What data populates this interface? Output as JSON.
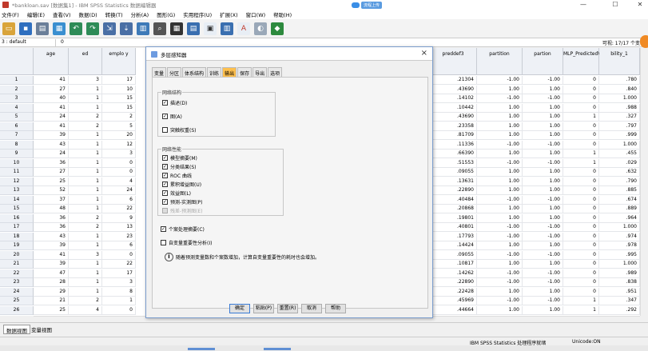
{
  "window": {
    "title": "*bankloan.sav [数据集1] - IBM SPSS Statistics 数据编辑器",
    "cloud_label": "流程上传",
    "controls": [
      "—",
      "☐",
      "✕"
    ]
  },
  "menu": [
    "文件(F)",
    "编辑(E)",
    "查看(V)",
    "数据(D)",
    "转换(T)",
    "分析(A)",
    "图形(G)",
    "实用程序(U)",
    "扩展(X)",
    "窗口(W)",
    "帮助(H)"
  ],
  "refbar": {
    "cell_ref": "3 : default",
    "cell_value": "0",
    "visible": "可视: 17/17 个变"
  },
  "columns": [
    {
      "label": "age",
      "icon": "scale-icon"
    },
    {
      "label": "ed",
      "icon": "ordinal-icon"
    },
    {
      "label": "emplo y",
      "icon": "scale-icon"
    },
    {
      "label": "preddef3",
      "icon": "scale-icon"
    },
    {
      "label": "partition",
      "icon": "nominal-icon"
    },
    {
      "label": "partion",
      "icon": "scale-icon"
    },
    {
      "label": "MLP_PredictedValue",
      "icon": "nominal-icon"
    },
    {
      "label": "bility_1",
      "icon": "scale-icon"
    }
  ],
  "rows": [
    {
      "n": "1",
      "age": "41",
      "ed": "3",
      "emp": "17",
      "pred": ".21304",
      "part": "-1.00",
      "parn": "-1.00",
      "mlp": "0",
      "prob": ".780"
    },
    {
      "n": "2",
      "age": "27",
      "ed": "1",
      "emp": "10",
      "pred": ".43690",
      "part": "1.00",
      "parn": "1.00",
      "mlp": "0",
      "prob": ".840"
    },
    {
      "n": "3",
      "age": "40",
      "ed": "1",
      "emp": "15",
      "pred": ".14102",
      "part": "-1.00",
      "parn": "-1.00",
      "mlp": "0",
      "prob": "1.000"
    },
    {
      "n": "4",
      "age": "41",
      "ed": "1",
      "emp": "15",
      "pred": ".10442",
      "part": "1.00",
      "parn": "1.00",
      "mlp": "0",
      "prob": ".988"
    },
    {
      "n": "5",
      "age": "24",
      "ed": "2",
      "emp": "2",
      "pred": ".43690",
      "part": "1.00",
      "parn": "1.00",
      "mlp": "1",
      "prob": ".327"
    },
    {
      "n": "6",
      "age": "41",
      "ed": "2",
      "emp": "5",
      "pred": ".23358",
      "part": "1.00",
      "parn": "1.00",
      "mlp": "0",
      "prob": ".797"
    },
    {
      "n": "7",
      "age": "39",
      "ed": "1",
      "emp": "20",
      "pred": ".81709",
      "part": "1.00",
      "parn": "1.00",
      "mlp": "0",
      "prob": ".999"
    },
    {
      "n": "8",
      "age": "43",
      "ed": "1",
      "emp": "12",
      "pred": ".11336",
      "part": "-1.00",
      "parn": "-1.00",
      "mlp": "0",
      "prob": "1.000"
    },
    {
      "n": "9",
      "age": "24",
      "ed": "1",
      "emp": "3",
      "pred": ".66390",
      "part": "1.00",
      "parn": "1.00",
      "mlp": "1",
      "prob": ".455"
    },
    {
      "n": "10",
      "age": "36",
      "ed": "1",
      "emp": "0",
      "pred": ".51553",
      "part": "-1.00",
      "parn": "-1.00",
      "mlp": "1",
      "prob": ".029"
    },
    {
      "n": "11",
      "age": "27",
      "ed": "1",
      "emp": "0",
      "pred": ".09055",
      "part": "1.00",
      "parn": "1.00",
      "mlp": "0",
      "prob": ".632"
    },
    {
      "n": "12",
      "age": "25",
      "ed": "1",
      "emp": "4",
      "pred": ".13631",
      "part": "1.00",
      "parn": "1.00",
      "mlp": "0",
      "prob": ".790"
    },
    {
      "n": "13",
      "age": "52",
      "ed": "1",
      "emp": "24",
      "pred": ".22890",
      "part": "1.00",
      "parn": "1.00",
      "mlp": "0",
      "prob": ".885"
    },
    {
      "n": "14",
      "age": "37",
      "ed": "1",
      "emp": "6",
      "pred": ".40484",
      "part": "-1.00",
      "parn": "-1.00",
      "mlp": "0",
      "prob": ".674"
    },
    {
      "n": "15",
      "age": "48",
      "ed": "1",
      "emp": "22",
      "pred": ".20868",
      "part": "1.00",
      "parn": "1.00",
      "mlp": "0",
      "prob": ".889"
    },
    {
      "n": "16",
      "age": "36",
      "ed": "2",
      "emp": "9",
      "pred": ".19801",
      "part": "1.00",
      "parn": "1.00",
      "mlp": "0",
      "prob": ".964"
    },
    {
      "n": "17",
      "age": "36",
      "ed": "2",
      "emp": "13",
      "pred": ".40801",
      "part": "-1.00",
      "parn": "-1.00",
      "mlp": "0",
      "prob": "1.000"
    },
    {
      "n": "18",
      "age": "43",
      "ed": "1",
      "emp": "23",
      "pred": ".17793",
      "part": "-1.00",
      "parn": "-1.00",
      "mlp": "0",
      "prob": ".974"
    },
    {
      "n": "19",
      "age": "39",
      "ed": "1",
      "emp": "6",
      "pred": ".14424",
      "part": "1.00",
      "parn": "1.00",
      "mlp": "0",
      "prob": ".978"
    },
    {
      "n": "20",
      "age": "41",
      "ed": "3",
      "emp": "0",
      "pred": ".09055",
      "part": "-1.00",
      "parn": "-1.00",
      "mlp": "0",
      "prob": ".995"
    },
    {
      "n": "21",
      "age": "39",
      "ed": "1",
      "emp": "22",
      "pred": ".10817",
      "part": "1.00",
      "parn": "1.00",
      "mlp": "0",
      "prob": "1.000"
    },
    {
      "n": "22",
      "age": "47",
      "ed": "1",
      "emp": "17",
      "pred": ".14262",
      "part": "-1.00",
      "parn": "-1.00",
      "mlp": "0",
      "prob": ".989"
    },
    {
      "n": "23",
      "age": "28",
      "ed": "1",
      "emp": "3",
      "pred": ".22890",
      "part": "-1.00",
      "parn": "-1.00",
      "mlp": "0",
      "prob": ".838"
    },
    {
      "n": "24",
      "age": "29",
      "ed": "1",
      "emp": "8",
      "pred": ".22428",
      "part": "1.00",
      "parn": "1.00",
      "mlp": "0",
      "prob": ".951"
    },
    {
      "n": "25",
      "age": "21",
      "ed": "2",
      "emp": "1",
      "pred": ".45969",
      "part": "-1.00",
      "parn": "-1.00",
      "mlp": "1",
      "prob": ".347"
    },
    {
      "n": "26",
      "age": "25",
      "ed": "4",
      "emp": "0",
      "pred": ".44664",
      "part": "1.00",
      "parn": "1.00",
      "mlp": "1",
      "prob": ".292"
    }
  ],
  "dialog": {
    "title": "多层感知器",
    "tabs": [
      "变量",
      "分区",
      "体系结构",
      "训练",
      "输出",
      "保存",
      "导出",
      "选项"
    ],
    "active_tab": "输出",
    "group1": {
      "label": "网络结构",
      "items": [
        {
          "label": "描述(D)",
          "checked": true
        },
        {
          "label": "图(A)",
          "checked": true
        },
        {
          "label": "突触权重(S)",
          "checked": false
        }
      ]
    },
    "group2": {
      "label": "网络性能",
      "items": [
        {
          "label": "模型摘要(M)",
          "checked": true
        },
        {
          "label": "分类结果(S)",
          "checked": true
        },
        {
          "label": "ROC 曲线",
          "checked": true
        },
        {
          "label": "累积增益图(U)",
          "checked": true
        },
        {
          "label": "效益图(L)",
          "checked": true
        },
        {
          "label": "预测-实测图(P)",
          "checked": true
        },
        {
          "label": "残差-预测图(E)",
          "checked": false,
          "disabled": true
        }
      ]
    },
    "summary_case": "个案处理摘要(C)",
    "importance": "自变量重要性分析(I)",
    "info": "随着预测变量数和个案数增加，计算自变量重要性的耗时也会增加。",
    "buttons": [
      "确定",
      "粘贴(P)",
      "重置(R)",
      "取消",
      "帮助"
    ]
  },
  "bottom_tabs": [
    "数据视图",
    "变量视图"
  ],
  "status": {
    "engine": "IBM SPSS Statistics 处理程序就绪",
    "unicode": "Unicode:ON"
  }
}
